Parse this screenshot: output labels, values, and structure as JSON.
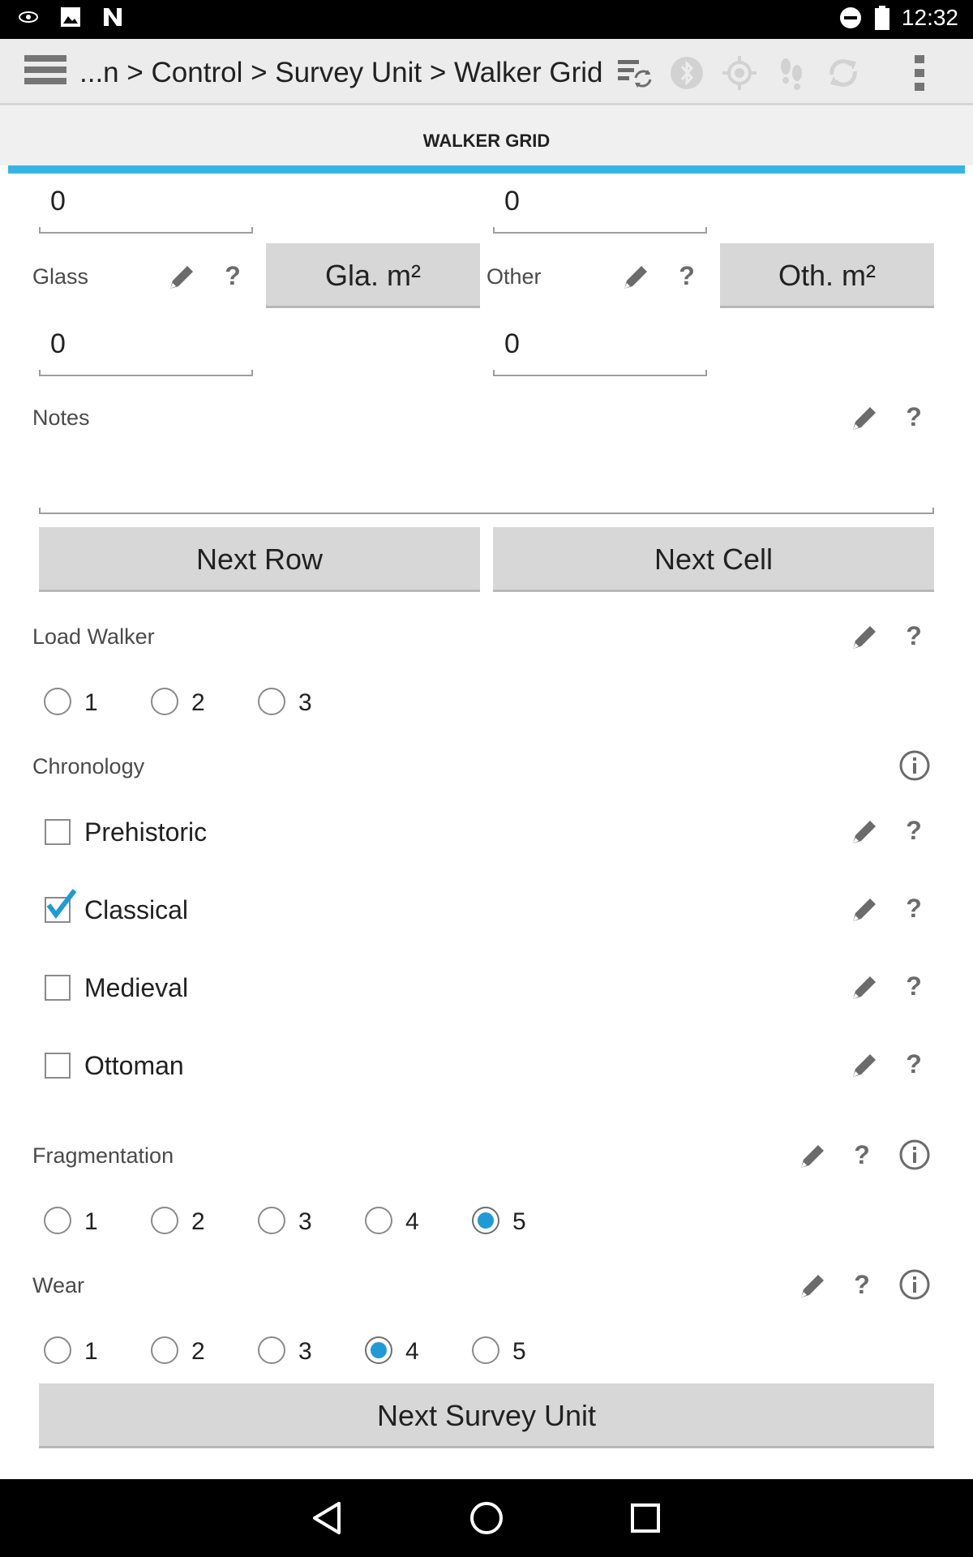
{
  "status_bar": {
    "time": "12:32",
    "left_icons": [
      "eye-notification-icon",
      "image-notification-icon",
      "n-notification-icon"
    ],
    "right_icons": [
      "do-not-disturb-icon",
      "battery-icon"
    ]
  },
  "action_bar": {
    "breadcrumb": "...n > Control > Survey Unit > Walker Grid",
    "icons": [
      "menu-icon",
      "sync-settings-icon",
      "bluetooth-icon",
      "gps-icon",
      "footsteps-icon",
      "refresh-icon",
      "overflow-menu-icon"
    ]
  },
  "section_title": "WALKER GRID",
  "top_fields": {
    "left_value": "0",
    "right_value": "0"
  },
  "glass": {
    "label": "Glass",
    "button": "Gla. m²",
    "value": "0"
  },
  "other": {
    "label": "Other",
    "button": "Oth. m²",
    "value": "0"
  },
  "notes": {
    "label": "Notes",
    "value": ""
  },
  "buttons": {
    "next_row": "Next Row",
    "next_cell": "Next Cell",
    "next_survey_unit": "Next Survey Unit"
  },
  "load_walker": {
    "label": "Load Walker",
    "options": [
      "1",
      "2",
      "3"
    ],
    "selected": null
  },
  "chronology": {
    "label": "Chronology",
    "items": [
      {
        "label": "Prehistoric",
        "checked": false
      },
      {
        "label": "Classical",
        "checked": true
      },
      {
        "label": "Medieval",
        "checked": false
      },
      {
        "label": "Ottoman",
        "checked": false
      }
    ]
  },
  "fragmentation": {
    "label": "Fragmentation",
    "options": [
      "1",
      "2",
      "3",
      "4",
      "5"
    ],
    "selected": "5"
  },
  "wear": {
    "label": "Wear",
    "options": [
      "1",
      "2",
      "3",
      "4",
      "5"
    ],
    "selected": "4"
  },
  "help_glyph": "?",
  "colors": {
    "accent": "#33b5e5",
    "radio_selected": "#1f9ad6",
    "button_bg": "#d7d7d7"
  }
}
